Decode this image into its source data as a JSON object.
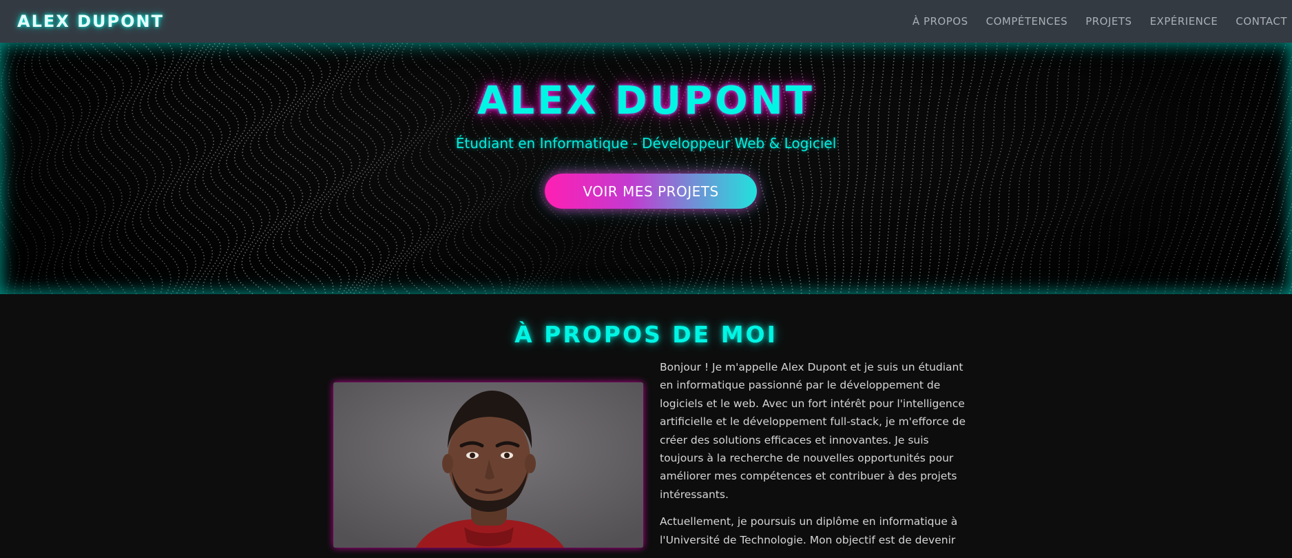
{
  "navbar": {
    "brand": "ALEX DUPONT",
    "links": [
      "À PROPOS",
      "COMPÉTENCES",
      "PROJETS",
      "EXPÉRIENCE",
      "CONTACT"
    ]
  },
  "hero": {
    "title": "ALEX DUPONT",
    "subtitle": "Étudiant en Informatique - Développeur Web & Logiciel",
    "button_label": "VOIR MES PROJETS"
  },
  "about": {
    "title": "À PROPOS DE MOI",
    "paragraphs": [
      "Bonjour ! Je m'appelle Alex Dupont et je suis un étudiant en informatique passionné par le développement de logiciels et le web. Avec un fort intérêt pour l'intelligence artificielle et le développement full-stack, je m'efforce de créer des solutions efficaces et innovantes. Je suis toujours à la recherche de nouvelles opportunités pour améliorer mes compétences et contribuer à des projets intéressants.",
      "Actuellement, je poursuis un diplôme en informatique à l'Université de Technologie. Mon objectif est de devenir"
    ]
  },
  "colors": {
    "accent_cyan": "#00f5e4",
    "accent_magenta": "#ff1fb3",
    "navbar_bg": "#343a42",
    "page_bg": "#0d0d0d"
  }
}
